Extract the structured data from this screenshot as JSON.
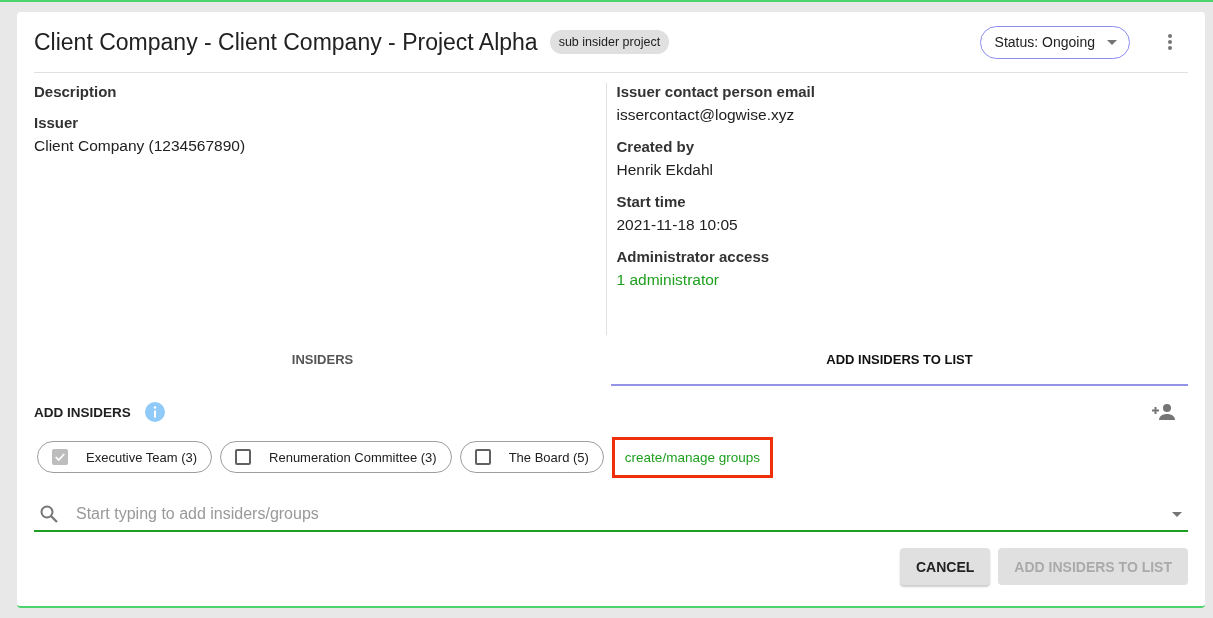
{
  "header": {
    "title": "Client Company - Client Company - Project Alpha",
    "badge": "sub insider project",
    "status": "Status: Ongoing"
  },
  "details_left": [
    {
      "label": "Description"
    },
    {
      "label": "Issuer",
      "value": "Client Company (1234567890)"
    }
  ],
  "details_right": [
    {
      "label": "Issuer contact person email",
      "value": "issercontact@logwise.xyz",
      "kind": "text"
    },
    {
      "label": "Created by",
      "value": "Henrik Ekdahl",
      "kind": "text"
    },
    {
      "label": "Start time",
      "value": "2021-11-18 10:05",
      "kind": "text"
    },
    {
      "label": "Administrator access",
      "value": "1 administrator",
      "kind": "link"
    }
  ],
  "tabs": [
    {
      "label": "INSIDERS",
      "selected": false
    },
    {
      "label": "ADD INSIDERS TO LIST",
      "selected": true
    }
  ],
  "add_insiders": {
    "heading": "ADD INSIDERS",
    "groups": [
      {
        "label": "Executive Team (3)",
        "checked": true,
        "disabled": true
      },
      {
        "label": "Renumeration Committee (3)",
        "checked": false,
        "disabled": false
      },
      {
        "label": "The Board (5)",
        "checked": false,
        "disabled": false
      }
    ],
    "manage_link": {
      "label": "create/manage groups",
      "highlighted": true
    },
    "search": {
      "placeholder": "Start typing to add insiders/groups"
    }
  },
  "buttons": [
    {
      "label": "CANCEL",
      "disabled": false
    },
    {
      "label": "ADD INSIDERS TO LIST",
      "disabled": true
    }
  ]
}
